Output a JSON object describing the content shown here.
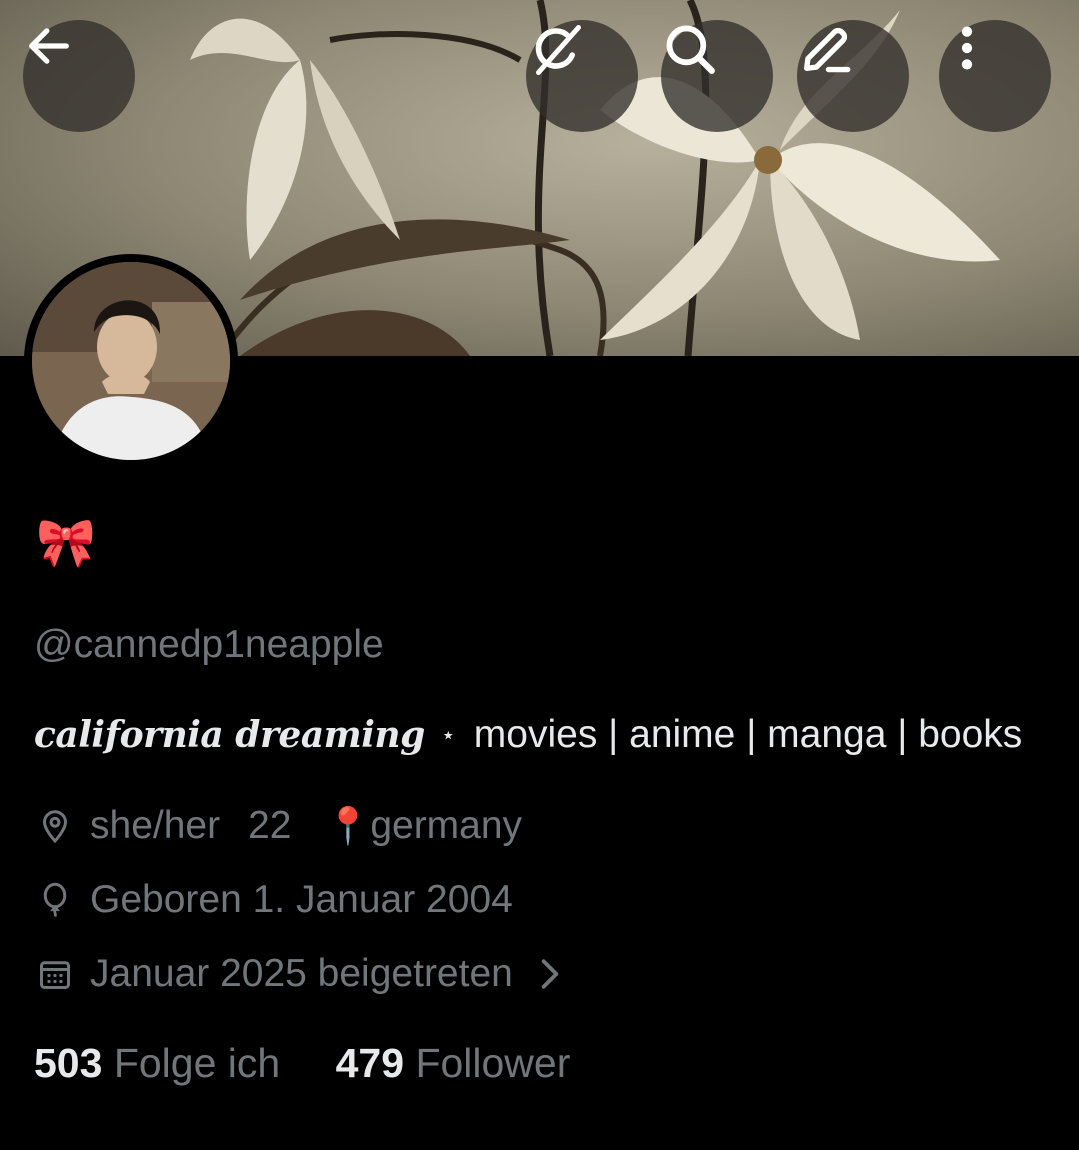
{
  "header": {
    "buttons": [
      {
        "name": "back-button",
        "icon": "arrow-left-icon"
      },
      {
        "name": "grok-button",
        "icon": "grok-icon"
      },
      {
        "name": "search-button",
        "icon": "search-icon"
      },
      {
        "name": "edit-button",
        "icon": "pencil-icon"
      },
      {
        "name": "more-button",
        "icon": "more-vertical-icon"
      }
    ]
  },
  "profile": {
    "display_name": "🎀",
    "handle": "@cannedp1neapple",
    "bio": {
      "italic_part": "california dreaming",
      "separator": "⋆",
      "rest": "movies | anime | manga | books"
    },
    "location_icon": "location-pin-icon",
    "location": {
      "pronouns": "she/her",
      "age": "22",
      "pin_emoji": "📍",
      "country": "germany"
    },
    "birthday_icon": "balloon-icon",
    "birthday": "Geboren 1. Januar 2004",
    "joined_icon": "calendar-icon",
    "joined": "Januar 2025 beigetreten",
    "stats": {
      "following_count": "503",
      "following_label": "Folge ich",
      "followers_count": "479",
      "followers_label": "Follower"
    }
  },
  "colors": {
    "background": "#000000",
    "text_primary": "#e7e9ea",
    "text_secondary": "#71767b",
    "button_bg": "#32302c"
  }
}
